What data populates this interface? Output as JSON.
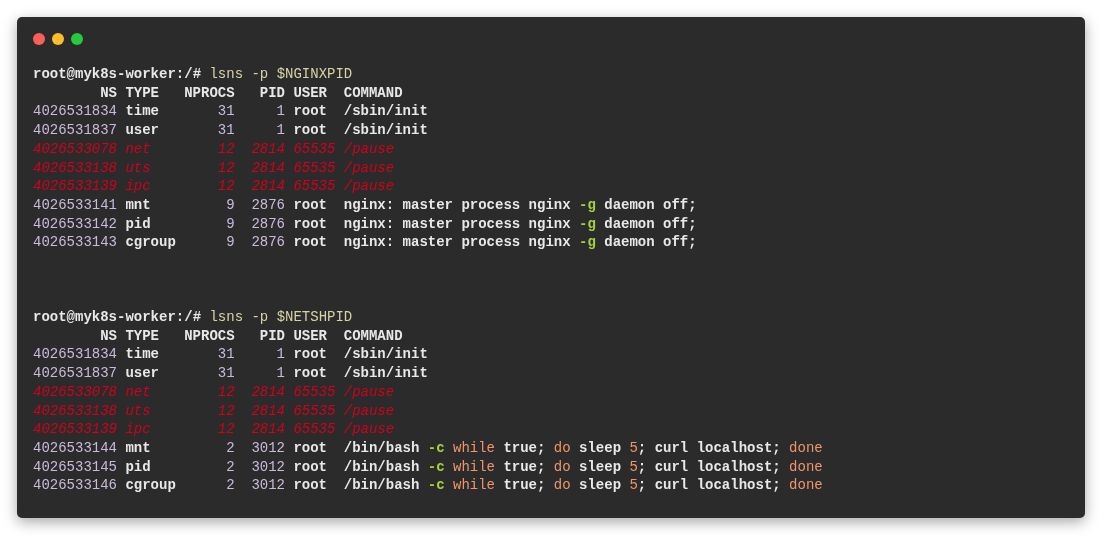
{
  "window": {
    "buttons": [
      {
        "kind": "close"
      },
      {
        "kind": "minimize"
      },
      {
        "kind": "zoom"
      }
    ]
  },
  "blocks": [
    {
      "prompt": "root@myk8s-worker:/#",
      "command": "lsns -p $NGINXPID",
      "columns": [
        "NS",
        "TYPE",
        "NPROCS",
        "PID",
        "USER",
        "COMMAND"
      ],
      "rows": [
        {
          "ns": "4026531834",
          "type": "time",
          "nprocs": "31",
          "pid": "1",
          "user": "root",
          "highlighted": false,
          "command": [
            {
              "text": "/sbin/init",
              "kind": "plain"
            }
          ]
        },
        {
          "ns": "4026531837",
          "type": "user",
          "nprocs": "31",
          "pid": "1",
          "user": "root",
          "highlighted": false,
          "command": [
            {
              "text": "/sbin/init",
              "kind": "plain"
            }
          ]
        },
        {
          "ns": "4026533078",
          "type": "net",
          "nprocs": "12",
          "pid": "2814",
          "user": "65535",
          "highlighted": true,
          "command": [
            {
              "text": "/pause",
              "kind": "plain"
            }
          ]
        },
        {
          "ns": "4026533138",
          "type": "uts",
          "nprocs": "12",
          "pid": "2814",
          "user": "65535",
          "highlighted": true,
          "command": [
            {
              "text": "/pause",
              "kind": "plain"
            }
          ]
        },
        {
          "ns": "4026533139",
          "type": "ipc",
          "nprocs": "12",
          "pid": "2814",
          "user": "65535",
          "highlighted": true,
          "command": [
            {
              "text": "/pause",
              "kind": "plain"
            }
          ]
        },
        {
          "ns": "4026533141",
          "type": "mnt",
          "nprocs": "9",
          "pid": "2876",
          "user": "root",
          "highlighted": false,
          "command": [
            {
              "text": "nginx: master process nginx ",
              "kind": "plain"
            },
            {
              "text": "-g",
              "kind": "flag"
            },
            {
              "text": " daemon off;",
              "kind": "plain"
            }
          ]
        },
        {
          "ns": "4026533142",
          "type": "pid",
          "nprocs": "9",
          "pid": "2876",
          "user": "root",
          "highlighted": false,
          "command": [
            {
              "text": "nginx: master process nginx ",
              "kind": "plain"
            },
            {
              "text": "-g",
              "kind": "flag"
            },
            {
              "text": " daemon off;",
              "kind": "plain"
            }
          ]
        },
        {
          "ns": "4026533143",
          "type": "cgroup",
          "nprocs": "9",
          "pid": "2876",
          "user": "root",
          "highlighted": false,
          "command": [
            {
              "text": "nginx: master process nginx ",
              "kind": "plain"
            },
            {
              "text": "-g",
              "kind": "flag"
            },
            {
              "text": " daemon off;",
              "kind": "plain"
            }
          ]
        }
      ]
    },
    {
      "prompt": "root@myk8s-worker:/#",
      "command": "lsns -p $NETSHPID",
      "columns": [
        "NS",
        "TYPE",
        "NPROCS",
        "PID",
        "USER",
        "COMMAND"
      ],
      "rows": [
        {
          "ns": "4026531834",
          "type": "time",
          "nprocs": "31",
          "pid": "1",
          "user": "root",
          "highlighted": false,
          "command": [
            {
              "text": "/sbin/init",
              "kind": "plain"
            }
          ]
        },
        {
          "ns": "4026531837",
          "type": "user",
          "nprocs": "31",
          "pid": "1",
          "user": "root",
          "highlighted": false,
          "command": [
            {
              "text": "/sbin/init",
              "kind": "plain"
            }
          ]
        },
        {
          "ns": "4026533078",
          "type": "net",
          "nprocs": "12",
          "pid": "2814",
          "user": "65535",
          "highlighted": true,
          "command": [
            {
              "text": "/pause",
              "kind": "plain"
            }
          ]
        },
        {
          "ns": "4026533138",
          "type": "uts",
          "nprocs": "12",
          "pid": "2814",
          "user": "65535",
          "highlighted": true,
          "command": [
            {
              "text": "/pause",
              "kind": "plain"
            }
          ]
        },
        {
          "ns": "4026533139",
          "type": "ipc",
          "nprocs": "12",
          "pid": "2814",
          "user": "65535",
          "highlighted": true,
          "command": [
            {
              "text": "/pause",
              "kind": "plain"
            }
          ]
        },
        {
          "ns": "4026533144",
          "type": "mnt",
          "nprocs": "2",
          "pid": "3012",
          "user": "root",
          "highlighted": false,
          "command": [
            {
              "text": "/bin/bash ",
              "kind": "plain"
            },
            {
              "text": "-c ",
              "kind": "flag"
            },
            {
              "text": "while",
              "kind": "keyword"
            },
            {
              "text": " true; ",
              "kind": "plain"
            },
            {
              "text": "do",
              "kind": "keyword"
            },
            {
              "text": " sleep ",
              "kind": "plain"
            },
            {
              "text": "5",
              "kind": "keyword"
            },
            {
              "text": "; curl localhost; ",
              "kind": "plain"
            },
            {
              "text": "done",
              "kind": "keyword"
            }
          ]
        },
        {
          "ns": "4026533145",
          "type": "pid",
          "nprocs": "2",
          "pid": "3012",
          "user": "root",
          "highlighted": false,
          "command": [
            {
              "text": "/bin/bash ",
              "kind": "plain"
            },
            {
              "text": "-c ",
              "kind": "flag"
            },
            {
              "text": "while",
              "kind": "keyword"
            },
            {
              "text": " true; ",
              "kind": "plain"
            },
            {
              "text": "do",
              "kind": "keyword"
            },
            {
              "text": " sleep ",
              "kind": "plain"
            },
            {
              "text": "5",
              "kind": "keyword"
            },
            {
              "text": "; curl localhost; ",
              "kind": "plain"
            },
            {
              "text": "done",
              "kind": "keyword"
            }
          ]
        },
        {
          "ns": "4026533146",
          "type": "cgroup",
          "nprocs": "2",
          "pid": "3012",
          "user": "root",
          "highlighted": false,
          "command": [
            {
              "text": "/bin/bash ",
              "kind": "plain"
            },
            {
              "text": "-c ",
              "kind": "flag"
            },
            {
              "text": "while",
              "kind": "keyword"
            },
            {
              "text": " true; ",
              "kind": "plain"
            },
            {
              "text": "do",
              "kind": "keyword"
            },
            {
              "text": " sleep ",
              "kind": "plain"
            },
            {
              "text": "5",
              "kind": "keyword"
            },
            {
              "text": "; curl localhost; ",
              "kind": "plain"
            },
            {
              "text": "done",
              "kind": "keyword"
            }
          ]
        }
      ]
    }
  ]
}
